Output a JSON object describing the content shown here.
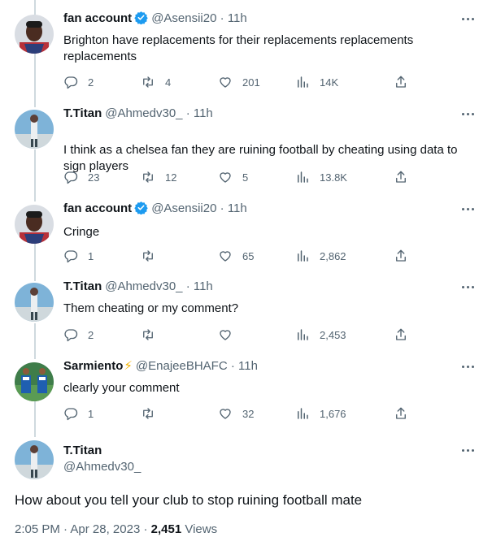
{
  "replies": [
    {
      "name": "fan account",
      "verified": true,
      "handle": "@Asensii20",
      "time": "11h",
      "text": "Brighton have replacements for their replacements replacements replacements",
      "replies": "2",
      "retweets": "4",
      "likes": "201",
      "views": "14K"
    },
    {
      "name": "T.Titan",
      "verified": false,
      "handle": "@Ahmedv30_",
      "time": "11h",
      "text": "I think as a chelsea fan they are ruining football by cheating using data to sign players",
      "replies": "23",
      "retweets": "12",
      "likes": "5",
      "views": "13.8K"
    },
    {
      "name": "fan account",
      "verified": true,
      "handle": "@Asensii20",
      "time": "11h",
      "text": "Cringe",
      "replies": "1",
      "retweets": "",
      "likes": "65",
      "views": "2,862"
    },
    {
      "name": "T.Titan",
      "verified": false,
      "handle": "@Ahmedv30_",
      "time": "11h",
      "text": "Them cheating or my comment?",
      "replies": "2",
      "retweets": "",
      "likes": "",
      "views": "2,453"
    },
    {
      "name": "Sarmiento",
      "name_emoji": "⚡",
      "verified": false,
      "handle": "@EnajeeBHAFC",
      "time": "11h",
      "text": "clearly your comment",
      "replies": "1",
      "retweets": "",
      "likes": "32",
      "views": "1,676"
    }
  ],
  "main_tweet": {
    "name": "T.Titan",
    "handle": "@Ahmedv30_",
    "text": "How about you tell your club to stop ruining football mate",
    "time": "2:05 PM",
    "date": "Apr 28, 2023",
    "views_count": "2,451",
    "views_label": "Views"
  },
  "separators": {
    "dot": "·"
  },
  "icons": {
    "reply": "reply-icon",
    "retweet": "retweet-icon",
    "like": "heart-icon",
    "views": "views-chart-icon",
    "share": "share-icon",
    "more": "more-dots-icon",
    "verified": "verified-badge-icon"
  },
  "colors": {
    "verified": "#1d9bf0",
    "secondary_text": "#536471",
    "thread_line": "#cfd9de",
    "primary_text": "#0f1419"
  }
}
